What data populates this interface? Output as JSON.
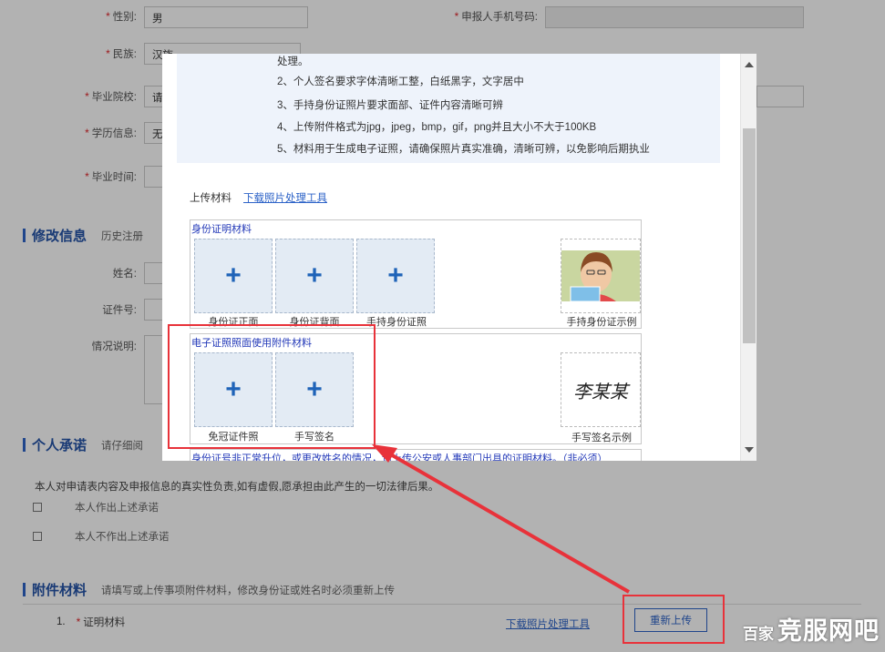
{
  "form": {
    "gender_label": "性别:",
    "gender_value": "男",
    "phone_label": "申报人手机号码:",
    "ethnicity_label": "民族:",
    "ethnicity_value": "汉族",
    "school_label": "毕业院校:",
    "school_value": "请",
    "education_label": "学历信息:",
    "education_value": "无",
    "gradtime_label": "毕业时间:"
  },
  "modify_section": {
    "title": "修改信息",
    "desc": "历史注册",
    "name_label": "姓名:",
    "id_label": "证件号:",
    "remark_label": "情况说明:"
  },
  "commit_section": {
    "title": "个人承诺",
    "desc": "请仔细阅",
    "statement": "本人对申请表内容及申报信息的真实性负责,如有虚假,愿承担由此产生的一切法律后果。",
    "option_yes": "本人作出上述承诺",
    "option_no": "本人不作出上述承诺"
  },
  "attach_section": {
    "title": "附件材料",
    "desc": "请填写或上传事项附件材料，修改身份证或姓名时必须重新上传",
    "row_index": "1.",
    "row_label": "证明材料",
    "row_link": "下载照片处理工具",
    "row_button": "重新上传"
  },
  "dialog": {
    "notes": [
      "处理。",
      "2、个人签名要求字体清晰工整，白纸黑字，文字居中",
      "3、手持身份证照片要求面部、证件内容清晰可辨",
      "4、上传附件格式为jpg，jpeg，bmp，gif，png并且大小不大于100KB",
      "5、材料用于生成电子证照，请确保照片真实准确，清晰可辨，以免影响后期执业"
    ],
    "upload_label": "上传材料",
    "download_link": "下载照片处理工具",
    "group1": {
      "title": "身份证明材料",
      "items": [
        "身份证正面",
        "身份证背面",
        "手持身份证照"
      ],
      "sample_caption": "手持身份证示例"
    },
    "group2": {
      "title": "电子证照照面使用附件材料",
      "items": [
        "免冠证件照",
        "手写签名"
      ],
      "sample_caption": "手写签名示例",
      "signature_text": "李某某"
    },
    "group3_title": "身份证号非正常升位，或更改姓名的情况，请上传公安或人事部门出具的证明材料。（非必须）"
  },
  "watermark": {
    "text1": "百家",
    "text2": "竞服网吧"
  },
  "colors": {
    "accent": "#2d63c8",
    "highlight": "#e8323a",
    "required": "#e0262b"
  }
}
